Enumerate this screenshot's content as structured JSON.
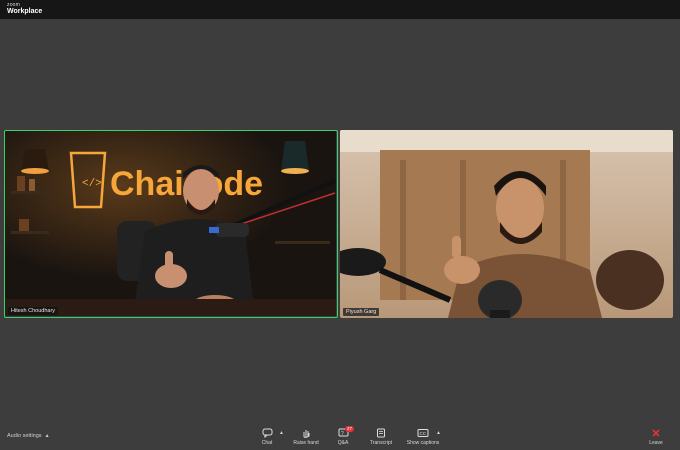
{
  "app": {
    "brand_top": "zoom",
    "brand_bottom": "Workplace"
  },
  "participants": [
    {
      "name": "Hitesh Choudhary",
      "active_speaker": true
    },
    {
      "name": "Piyush Garg",
      "active_speaker": false
    }
  ],
  "background_sign": {
    "text": "Chaicode"
  },
  "toolbar": {
    "audio_settings": "Audio settings",
    "chat": "Chat",
    "raise_hand": "Raise hand",
    "qa": "Q&A",
    "qa_badge": "27",
    "transcript": "Transcript",
    "show_captions": "Show captions",
    "leave": "Leave"
  },
  "colors": {
    "active_speaker_border": "#3ad06b",
    "leave_icon": "#e0333a",
    "badge": "#e0333a"
  },
  "icons": [
    "chat-icon",
    "raise-hand-icon",
    "qa-icon",
    "transcript-icon",
    "captions-icon",
    "leave-icon"
  ]
}
